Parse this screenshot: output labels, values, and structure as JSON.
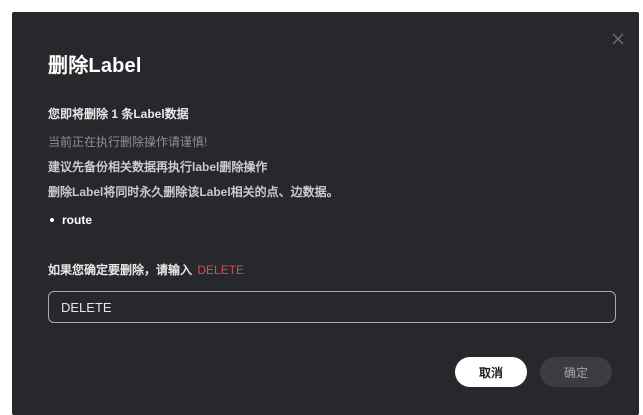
{
  "dialog": {
    "title": "删除Label",
    "summary": "您即将删除 1 条Label数据",
    "warning": "当前正在执行删除操作请谨慎!",
    "advice": "建议先备份相关数据再执行label删除操作",
    "consequence": "删除Label将同时永久删除该Label相关的点、边数据。",
    "labels": [
      "route"
    ],
    "confirm_prefix": "如果您确定要删除，请输入",
    "confirm_keyword": "DELETE",
    "input_value": "DELETE",
    "cancel_label": "取消",
    "ok_label": "确定",
    "close_icon": "close-icon"
  },
  "colors": {
    "background": "#27282b",
    "keyword": "#e04a4a",
    "cancel_bg": "#ffffff",
    "ok_bg": "#3b3c40"
  }
}
